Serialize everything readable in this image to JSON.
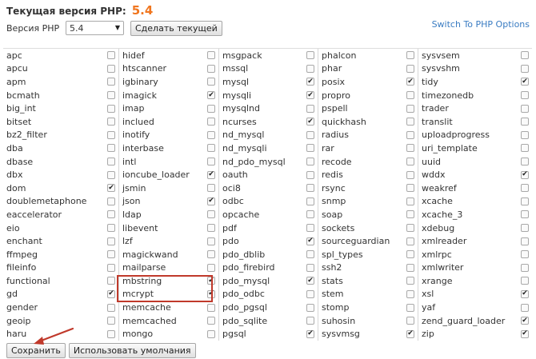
{
  "header": {
    "title_label": "Текущая версия PHP:",
    "current_version": "5.4",
    "version_label": "Версия PHP",
    "selected_version": "5.4",
    "set_current_button": "Сделать текущей",
    "switch_link": "Switch To PHP Options"
  },
  "extensions": {
    "columns": [
      [
        {
          "name": "apc",
          "checked": false
        },
        {
          "name": "apcu",
          "checked": false
        },
        {
          "name": "apm",
          "checked": false
        },
        {
          "name": "bcmath",
          "checked": false
        },
        {
          "name": "big_int",
          "checked": false
        },
        {
          "name": "bitset",
          "checked": false
        },
        {
          "name": "bz2_filter",
          "checked": false
        },
        {
          "name": "dba",
          "checked": false
        },
        {
          "name": "dbase",
          "checked": false
        },
        {
          "name": "dbx",
          "checked": false
        },
        {
          "name": "dom",
          "checked": true
        },
        {
          "name": "doublemetaphone",
          "checked": false
        },
        {
          "name": "eaccelerator",
          "checked": false
        },
        {
          "name": "eio",
          "checked": false
        },
        {
          "name": "enchant",
          "checked": false
        },
        {
          "name": "ffmpeg",
          "checked": false
        },
        {
          "name": "fileinfo",
          "checked": false
        },
        {
          "name": "functional",
          "checked": false
        },
        {
          "name": "gd",
          "checked": true
        },
        {
          "name": "gender",
          "checked": false
        },
        {
          "name": "geoip",
          "checked": false
        },
        {
          "name": "haru",
          "checked": false
        }
      ],
      [
        {
          "name": "hidef",
          "checked": false
        },
        {
          "name": "htscanner",
          "checked": false
        },
        {
          "name": "igbinary",
          "checked": false
        },
        {
          "name": "imagick",
          "checked": true
        },
        {
          "name": "imap",
          "checked": false
        },
        {
          "name": "inclued",
          "checked": false
        },
        {
          "name": "inotify",
          "checked": false
        },
        {
          "name": "interbase",
          "checked": false
        },
        {
          "name": "intl",
          "checked": false
        },
        {
          "name": "ioncube_loader",
          "checked": true
        },
        {
          "name": "jsmin",
          "checked": false
        },
        {
          "name": "json",
          "checked": true
        },
        {
          "name": "ldap",
          "checked": false
        },
        {
          "name": "libevent",
          "checked": false
        },
        {
          "name": "lzf",
          "checked": false
        },
        {
          "name": "magickwand",
          "checked": false
        },
        {
          "name": "mailparse",
          "checked": false
        },
        {
          "name": "mbstring",
          "checked": true
        },
        {
          "name": "mcrypt",
          "checked": true
        },
        {
          "name": "memcache",
          "checked": false
        },
        {
          "name": "memcached",
          "checked": false
        },
        {
          "name": "mongo",
          "checked": false
        }
      ],
      [
        {
          "name": "msgpack",
          "checked": false
        },
        {
          "name": "mssql",
          "checked": false
        },
        {
          "name": "mysql",
          "checked": true
        },
        {
          "name": "mysqli",
          "checked": true
        },
        {
          "name": "mysqlnd",
          "checked": false
        },
        {
          "name": "ncurses",
          "checked": true
        },
        {
          "name": "nd_mysql",
          "checked": false
        },
        {
          "name": "nd_mysqli",
          "checked": false
        },
        {
          "name": "nd_pdo_mysql",
          "checked": false
        },
        {
          "name": "oauth",
          "checked": false
        },
        {
          "name": "oci8",
          "checked": false
        },
        {
          "name": "odbc",
          "checked": false
        },
        {
          "name": "opcache",
          "checked": false
        },
        {
          "name": "pdf",
          "checked": false
        },
        {
          "name": "pdo",
          "checked": true
        },
        {
          "name": "pdo_dblib",
          "checked": false
        },
        {
          "name": "pdo_firebird",
          "checked": false
        },
        {
          "name": "pdo_mysql",
          "checked": true
        },
        {
          "name": "pdo_odbc",
          "checked": false
        },
        {
          "name": "pdo_pgsql",
          "checked": false
        },
        {
          "name": "pdo_sqlite",
          "checked": false
        },
        {
          "name": "pgsql",
          "checked": true
        }
      ],
      [
        {
          "name": "phalcon",
          "checked": false
        },
        {
          "name": "phar",
          "checked": false
        },
        {
          "name": "posix",
          "checked": true
        },
        {
          "name": "propro",
          "checked": false
        },
        {
          "name": "pspell",
          "checked": false
        },
        {
          "name": "quickhash",
          "checked": false
        },
        {
          "name": "radius",
          "checked": false
        },
        {
          "name": "rar",
          "checked": false
        },
        {
          "name": "recode",
          "checked": false
        },
        {
          "name": "redis",
          "checked": false
        },
        {
          "name": "rsync",
          "checked": false
        },
        {
          "name": "snmp",
          "checked": false
        },
        {
          "name": "soap",
          "checked": false
        },
        {
          "name": "sockets",
          "checked": false
        },
        {
          "name": "sourceguardian",
          "checked": false
        },
        {
          "name": "spl_types",
          "checked": false
        },
        {
          "name": "ssh2",
          "checked": false
        },
        {
          "name": "stats",
          "checked": false
        },
        {
          "name": "stem",
          "checked": false
        },
        {
          "name": "stomp",
          "checked": false
        },
        {
          "name": "suhosin",
          "checked": false
        },
        {
          "name": "sysvmsg",
          "checked": true
        }
      ],
      [
        {
          "name": "sysvsem",
          "checked": false
        },
        {
          "name": "sysvshm",
          "checked": false
        },
        {
          "name": "tidy",
          "checked": true
        },
        {
          "name": "timezonedb",
          "checked": false
        },
        {
          "name": "trader",
          "checked": false
        },
        {
          "name": "translit",
          "checked": false
        },
        {
          "name": "uploadprogress",
          "checked": false
        },
        {
          "name": "uri_template",
          "checked": false
        },
        {
          "name": "uuid",
          "checked": false
        },
        {
          "name": "wddx",
          "checked": true
        },
        {
          "name": "weakref",
          "checked": false
        },
        {
          "name": "xcache",
          "checked": false
        },
        {
          "name": "xcache_3",
          "checked": false
        },
        {
          "name": "xdebug",
          "checked": false
        },
        {
          "name": "xmlreader",
          "checked": false
        },
        {
          "name": "xmlrpc",
          "checked": false
        },
        {
          "name": "xmlwriter",
          "checked": false
        },
        {
          "name": "xrange",
          "checked": false
        },
        {
          "name": "xsl",
          "checked": true
        },
        {
          "name": "yaf",
          "checked": false
        },
        {
          "name": "zend_guard_loader",
          "checked": true
        },
        {
          "name": "zip",
          "checked": true
        }
      ]
    ]
  },
  "footer": {
    "save_button": "Сохранить",
    "defaults_button": "Использовать умолчания"
  },
  "colors": {
    "version_accent": "#f0761f",
    "link": "#3a7cc2",
    "highlight": "#c0392b"
  }
}
